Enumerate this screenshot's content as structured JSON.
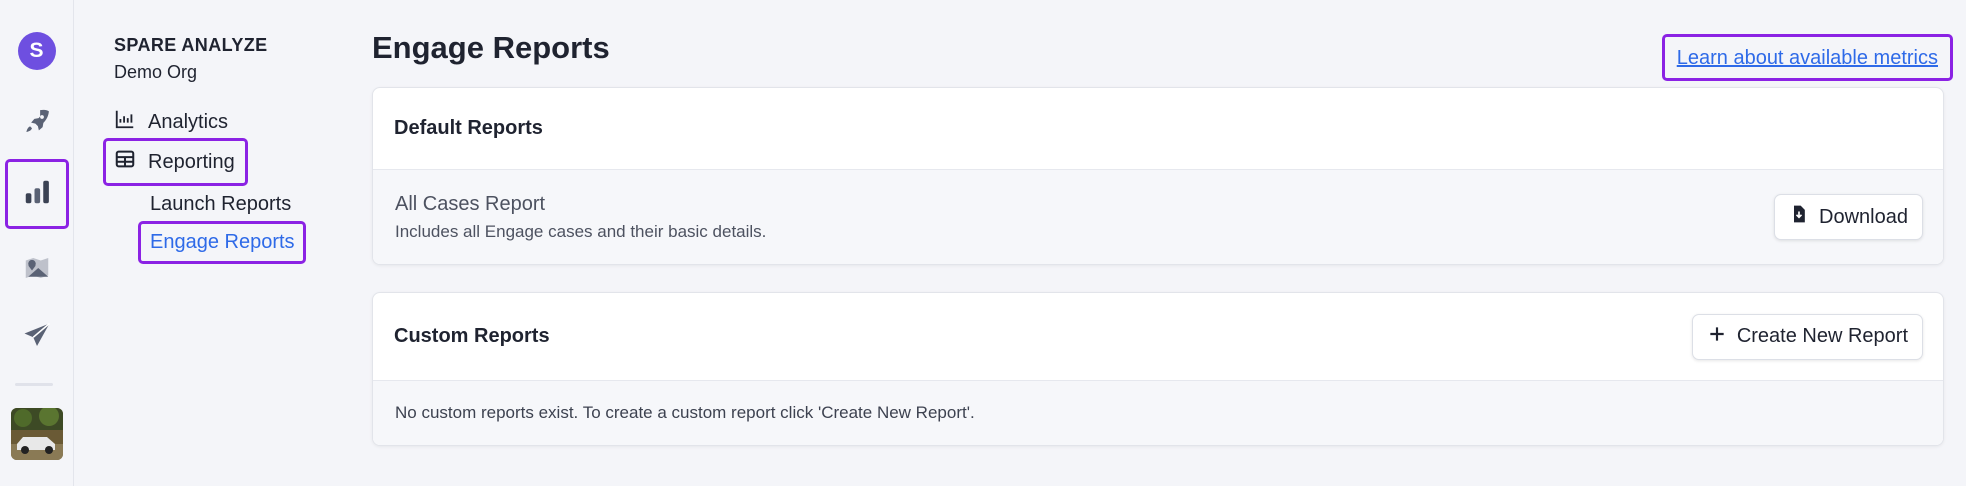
{
  "rail": {
    "brand_letter": "S",
    "items": [
      {
        "icon": "rocket-icon"
      },
      {
        "icon": "bar-chart-icon"
      },
      {
        "icon": "map-icon"
      },
      {
        "icon": "paper-plane-icon"
      }
    ]
  },
  "nav": {
    "org_title": "SPARE ANALYZE",
    "org_name": "Demo Org",
    "analytics_label": "Analytics",
    "reporting_label": "Reporting",
    "launch_reports_label": "Launch Reports",
    "engage_reports_label": "Engage Reports"
  },
  "main": {
    "title": "Engage Reports",
    "metrics_link": "Learn about available metrics",
    "default_reports": {
      "heading": "Default Reports",
      "report_name": "All Cases Report",
      "report_desc": "Includes all Engage cases and their basic details.",
      "download_label": "Download"
    },
    "custom_reports": {
      "heading": "Custom Reports",
      "create_label": "Create New Report",
      "empty_text": "No custom reports exist. To create a custom report click 'Create New Report'."
    }
  },
  "colors": {
    "accent": "#6e4fe0",
    "link": "#2e6ae8",
    "highlight": "#8b22e4"
  }
}
